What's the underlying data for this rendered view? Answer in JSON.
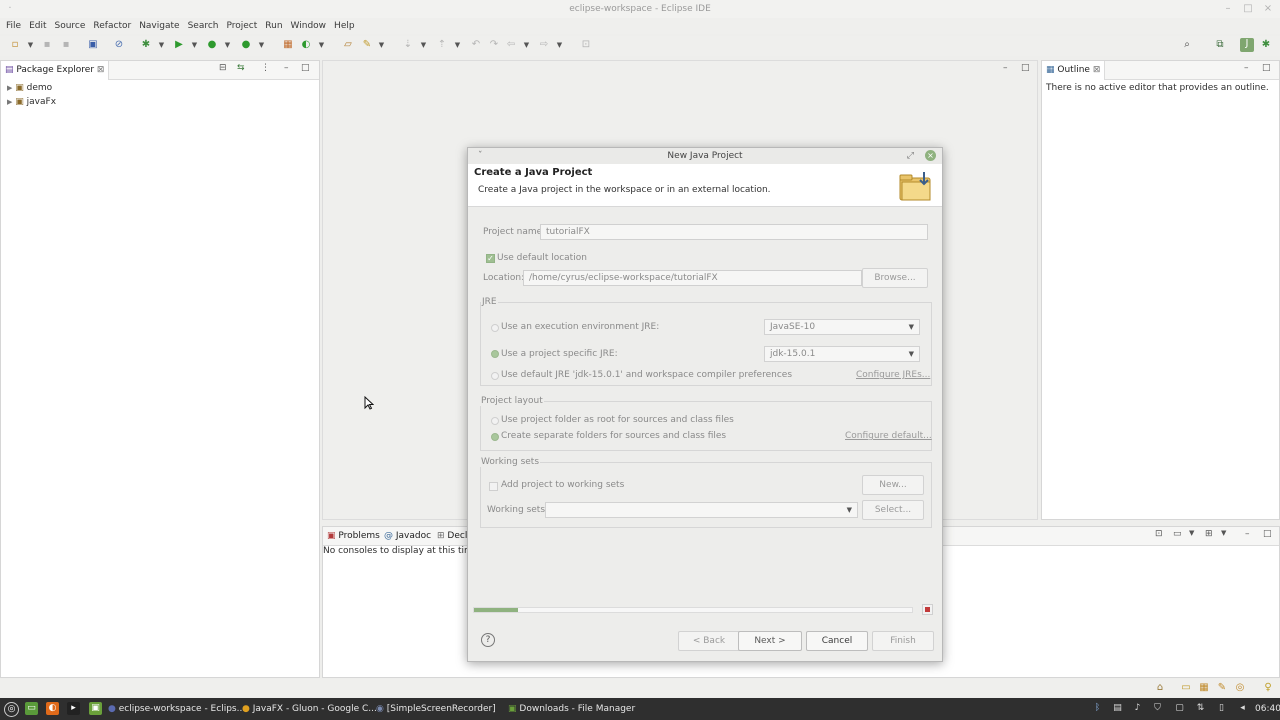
{
  "window": {
    "title": "eclipse-workspace - Eclipse IDE"
  },
  "menubar": [
    "File",
    "Edit",
    "Source",
    "Refactor",
    "Navigate",
    "Search",
    "Project",
    "Run",
    "Window",
    "Help"
  ],
  "package_explorer": {
    "tab_label": "Package Explorer",
    "items": [
      {
        "label": "demo"
      },
      {
        "label": "javaFx"
      }
    ]
  },
  "outline": {
    "tab_label": "Outline",
    "message": "There is no active editor that provides an outline."
  },
  "bottom_panel": {
    "tabs": [
      "Problems",
      "Javadoc",
      "Decl"
    ],
    "message": "No consoles to display at this time."
  },
  "dialog": {
    "title": "New Java Project",
    "heading": "Create a Java Project",
    "description": "Create a Java project in the workspace or in an external location.",
    "project_name_label": "Project name:",
    "project_name_value": "tutorialFX",
    "use_default_location_label": "Use default location",
    "use_default_location_checked": true,
    "location_label": "Location:",
    "location_value": "/home/cyrus/eclipse-workspace/tutorialFX",
    "browse_label": "Browse...",
    "jre_group": {
      "title": "JRE",
      "option_env_label": "Use an execution environment JRE:",
      "option_env_value": "JavaSE-10",
      "option_specific_label": "Use a project specific JRE:",
      "option_specific_value": "jdk-15.0.1",
      "option_default_label": "Use default JRE 'jdk-15.0.1' and workspace compiler preferences",
      "configure_link": "Configure JREs...",
      "selected": "specific"
    },
    "layout_group": {
      "title": "Project layout",
      "option_root_label": "Use project folder as root for sources and class files",
      "option_separate_label": "Create separate folders for sources and class files",
      "configure_link": "Configure default...",
      "selected": "separate"
    },
    "working_sets_group": {
      "title": "Working sets",
      "add_label": "Add project to working sets",
      "new_button": "New...",
      "working_sets_label": "Working sets:",
      "working_sets_value": "",
      "select_button": "Select..."
    },
    "progress_fraction": 0.1,
    "buttons": {
      "back": "< Back",
      "next": "Next >",
      "cancel": "Cancel",
      "finish": "Finish"
    }
  },
  "taskbar": {
    "items": [
      {
        "label": "eclipse-workspace - Eclips..."
      },
      {
        "label": "JavaFX - Gluon - Google C..."
      },
      {
        "label": "[SimpleScreenRecorder]"
      },
      {
        "label": "Downloads - File Manager"
      }
    ],
    "clock": "06:40"
  },
  "colors": {
    "accent_green": "#7fa66f",
    "progress_fill": "#8fb27f",
    "stop_red": "#c23a3a"
  }
}
